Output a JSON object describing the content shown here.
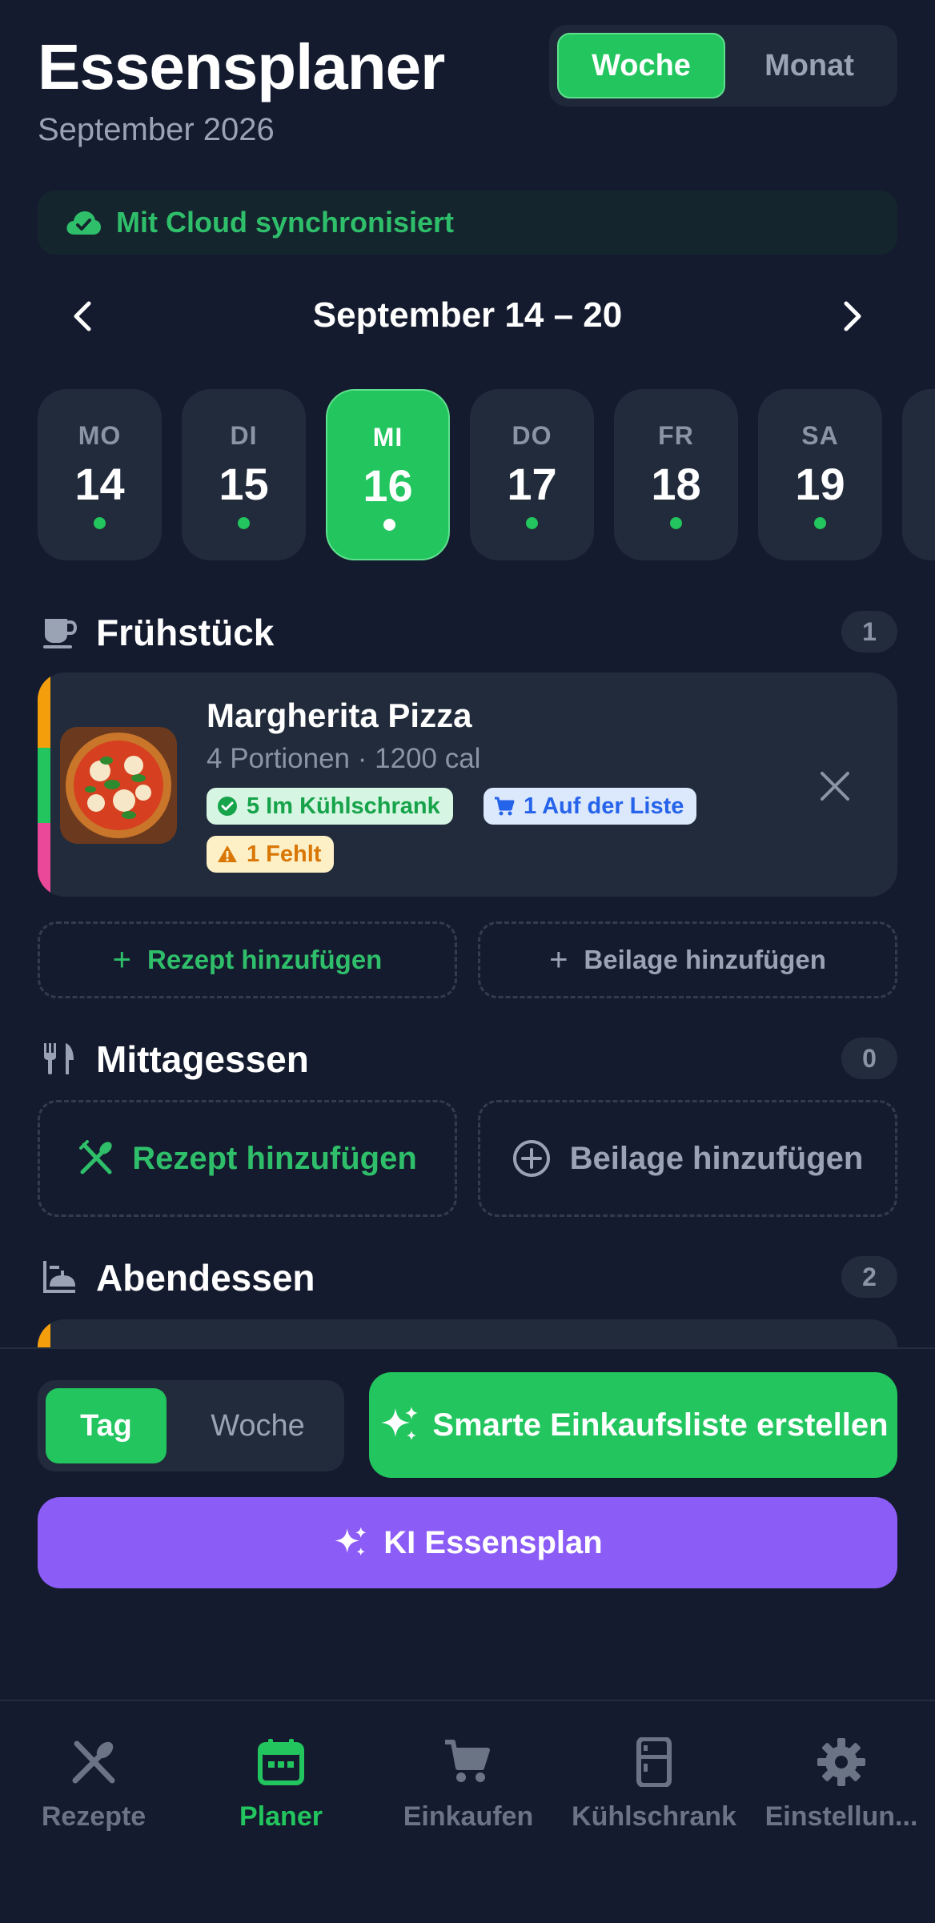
{
  "header": {
    "title": "Essensplaner",
    "subtitle": "September 2026",
    "view_toggle": {
      "week": "Woche",
      "month": "Monat",
      "selected": "Woche"
    }
  },
  "sync": {
    "label": "Mit Cloud synchronisiert",
    "icon": "cloud-check-icon"
  },
  "week_nav": {
    "label": "September 14 – 20",
    "prev_icon": "chevron-left-icon",
    "next_icon": "chevron-right-icon"
  },
  "days": [
    {
      "name": "MO",
      "date": "14",
      "has_meals": true
    },
    {
      "name": "DI",
      "date": "15",
      "has_meals": true
    },
    {
      "name": "MI",
      "date": "16",
      "has_meals": true,
      "selected": true
    },
    {
      "name": "DO",
      "date": "17",
      "has_meals": true
    },
    {
      "name": "FR",
      "date": "18",
      "has_meals": true
    },
    {
      "name": "SA",
      "date": "19",
      "has_meals": true
    }
  ],
  "sections": {
    "breakfast": {
      "title": "Frühstück",
      "count": "1",
      "icon": "coffee-cup-icon",
      "meal": {
        "title": "Margherita Pizza",
        "subtitle": "4 Portionen · 1200 cal",
        "badge_fridge": "5 Im Kühlschrank",
        "badge_list": "1 Auf der Liste",
        "badge_missing": "1 Fehlt"
      },
      "add_recipe": "Rezept hinzufügen",
      "add_side": "Beilage hinzufügen"
    },
    "lunch": {
      "title": "Mittagessen",
      "count": "0",
      "icon": "fork-knife-icon",
      "add_recipe": "Rezept hinzufügen",
      "add_side": "Beilage hinzufügen"
    },
    "dinner": {
      "title": "Abendessen",
      "count": "2",
      "icon": "dinner-plate-icon"
    }
  },
  "actions": {
    "scope_toggle": {
      "day": "Tag",
      "week": "Woche",
      "selected": "Tag"
    },
    "smart_list": "Smarte Einkaufsliste erstellen",
    "ai_plan": "KI Essensplan"
  },
  "tabbar": [
    {
      "label": "Rezepte",
      "icon": "utensils-crossed-icon"
    },
    {
      "label": "Planer",
      "icon": "calendar-icon",
      "active": true
    },
    {
      "label": "Einkaufen",
      "icon": "cart-icon"
    },
    {
      "label": "Kühlschrank",
      "icon": "fridge-icon"
    },
    {
      "label": "Einstellun...",
      "icon": "gear-icon"
    }
  ],
  "colors": {
    "background": "#141b2e",
    "card": "#222b3b",
    "accent_green": "#22c55e",
    "accent_purple": "#8b5cf6",
    "muted_text": "#8b94a5"
  }
}
